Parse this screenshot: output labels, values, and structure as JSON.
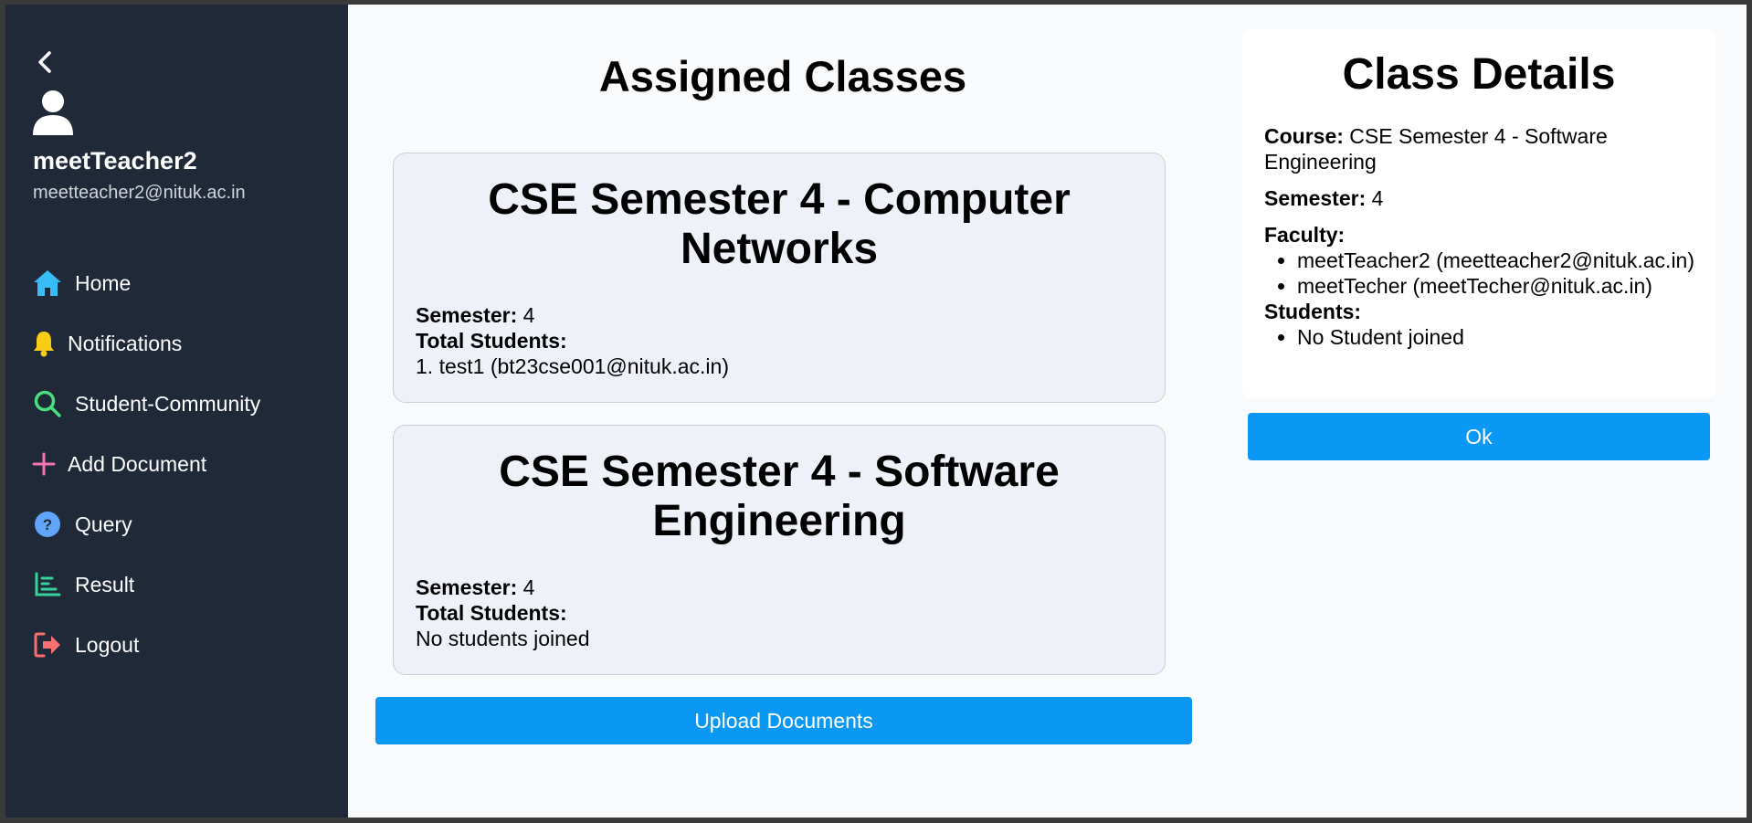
{
  "sidebar": {
    "user": {
      "name": "meetTeacher2",
      "email": "meetteacher2@nituk.ac.in"
    },
    "items": [
      {
        "label": "Home",
        "icon": "home-icon",
        "color": "#38bdf8"
      },
      {
        "label": "Notifications",
        "icon": "bell-icon",
        "color": "#facc15"
      },
      {
        "label": "Student-Community",
        "icon": "search-icon",
        "color": "#4ade80"
      },
      {
        "label": "Add Document",
        "icon": "plus-icon",
        "color": "#f472b6"
      },
      {
        "label": "Query",
        "icon": "question-icon",
        "color": "#60a5fa"
      },
      {
        "label": "Result",
        "icon": "chart-icon",
        "color": "#34d399"
      },
      {
        "label": "Logout",
        "icon": "logout-icon",
        "color": "#f87171"
      }
    ]
  },
  "main": {
    "title": "Assigned Classes",
    "classes": [
      {
        "title": "CSE Semester 4 - Computer Networks",
        "semester_label": "Semester:",
        "semester": "4",
        "total_students_label": "Total Students:",
        "students": [
          "test1 (bt23cse001@nituk.ac.in)"
        ]
      },
      {
        "title": "CSE Semester 4 - Software Engineering",
        "semester_label": "Semester:",
        "semester": "4",
        "total_students_label": "Total Students:",
        "empty_text": "No students joined"
      }
    ],
    "upload_button": "Upload Documents"
  },
  "details": {
    "title": "Class Details",
    "course_label": "Course:",
    "course": "CSE Semester 4 - Software Engineering",
    "semester_label": "Semester:",
    "semester": "4",
    "faculty_label": "Faculty:",
    "faculty": [
      "meetTeacher2 (meetteacher2@nituk.ac.in)",
      "meetTecher (meetTecher@nituk.ac.in)"
    ],
    "students_label": "Students:",
    "students": [
      "No Student joined"
    ],
    "ok_button": "Ok"
  },
  "colors": {
    "sidebar_bg": "#1f2937",
    "accent": "#0b97f4",
    "card_bg": "#eef2f8"
  }
}
